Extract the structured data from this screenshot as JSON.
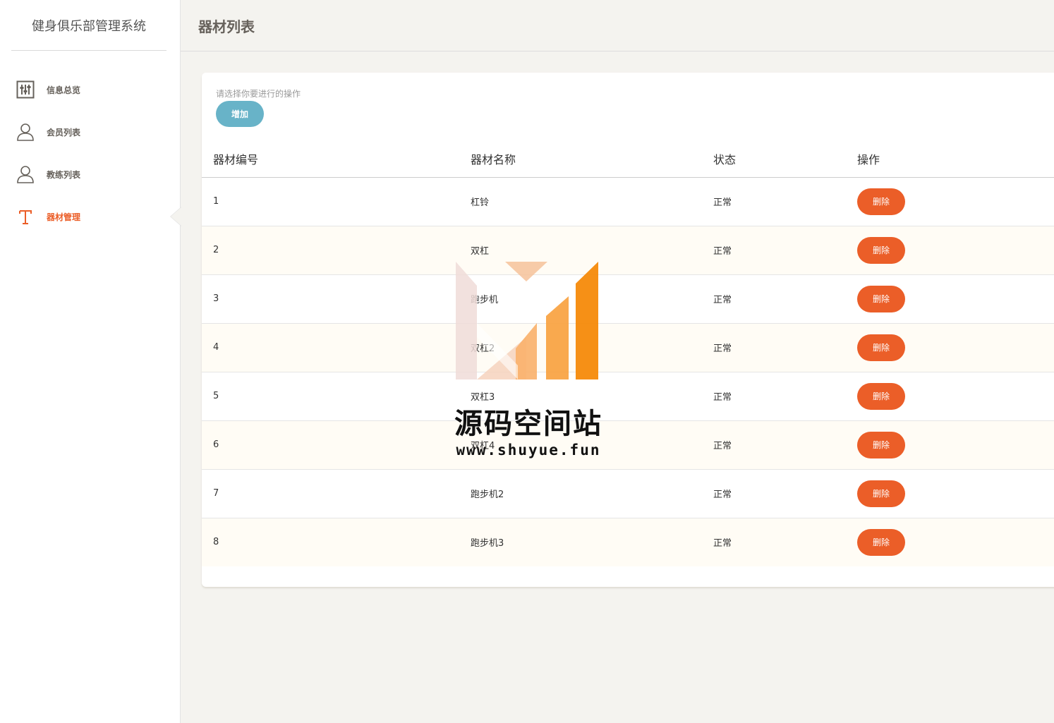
{
  "app": {
    "title": "健身俱乐部管理系统"
  },
  "sidebar": {
    "items": [
      {
        "label": "信息总览",
        "icon": "panel-settings-icon",
        "active": false
      },
      {
        "label": "会员列表",
        "icon": "user-icon",
        "active": false
      },
      {
        "label": "教练列表",
        "icon": "user-icon",
        "active": false
      },
      {
        "label": "器材管理",
        "icon": "text-t-icon",
        "active": true
      }
    ]
  },
  "header": {
    "title": "器材列表"
  },
  "main": {
    "hint": "请选择你要进行的操作",
    "add_label": "增加",
    "table": {
      "columns": [
        "器材编号",
        "器材名称",
        "状态",
        "操作"
      ],
      "rows": [
        {
          "id": "1",
          "name": "杠铃",
          "status": "正常",
          "action": "删除"
        },
        {
          "id": "2",
          "name": "双杠",
          "status": "正常",
          "action": "删除"
        },
        {
          "id": "3",
          "name": "跑步机",
          "status": "正常",
          "action": "删除"
        },
        {
          "id": "4",
          "name": "双杠2",
          "status": "正常",
          "action": "删除"
        },
        {
          "id": "5",
          "name": "双杠3",
          "status": "正常",
          "action": "删除"
        },
        {
          "id": "6",
          "name": "双杠4",
          "status": "正常",
          "action": "删除"
        },
        {
          "id": "7",
          "name": "跑步机2",
          "status": "正常",
          "action": "删除"
        },
        {
          "id": "8",
          "name": "跑步机3",
          "status": "正常",
          "action": "删除"
        }
      ]
    }
  },
  "watermark": {
    "title": "源码空间站",
    "url": "www.shuyue.fun"
  },
  "colors": {
    "accent": "#eb5e28",
    "info": "#68b3c8",
    "background": "#f4f3ef"
  }
}
